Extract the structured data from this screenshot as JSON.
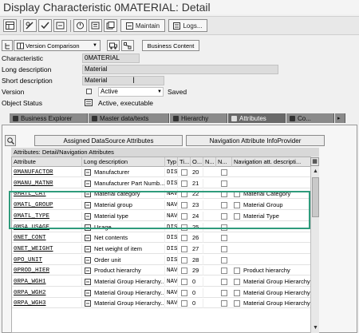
{
  "window": {
    "title": "Display Characteristic 0MATERIAL: Detail"
  },
  "toolbar": {
    "maintain_label": "Maintain",
    "logs_label": "Logs..."
  },
  "app_toolbar": {
    "version_comparison": "Version Comparison",
    "business_content": "Business Content"
  },
  "form": {
    "characteristic": {
      "label": "Characteristic",
      "value": "0MATERIAL"
    },
    "long_description": {
      "label": "Long description",
      "value": "Material"
    },
    "short_description": {
      "label": "Short description",
      "value": "Material"
    },
    "version": {
      "label": "Version",
      "value": "Active",
      "status": "Saved"
    },
    "object_status": {
      "label": "Object Status",
      "value": "Active, executable"
    }
  },
  "tabs": [
    "Business Explorer",
    "Master data/texts",
    "Hierarchy",
    "Attributes",
    "Co..."
  ],
  "active_tab": "Attributes",
  "panel": {
    "btn_assigned": "Assigned DataSource Attributes",
    "btn_nav": "Navigation Attribute InfoProvider",
    "grid_title": "Attributes: Detail/Navigation Attributes"
  },
  "grid": {
    "columns": [
      "Attribute",
      "Long description",
      "Typ",
      "Ti...",
      "O...",
      "N...",
      "T...",
      "Navigation att. descripti..."
    ],
    "rows": [
      {
        "attr": "0MANUFACTOR",
        "desc": "Manufacturer",
        "typ": "DIS",
        "o": "20",
        "nav_desc": ""
      },
      {
        "attr": "0MANU_MATNR",
        "desc": "Manufacturer Part Numb...",
        "typ": "DIS",
        "o": "21",
        "nav_desc": ""
      },
      {
        "attr": "0MATL_CAT",
        "desc": "Material category",
        "typ": "NAV",
        "o": "22",
        "nav_desc": "Material Category"
      },
      {
        "attr": "0MATL_GROUP",
        "desc": "Material group",
        "typ": "NAV",
        "o": "23",
        "nav_desc": "Material Group"
      },
      {
        "attr": "0MATL_TYPE",
        "desc": "Material type",
        "typ": "NAV",
        "o": "24",
        "nav_desc": "Material Type"
      },
      {
        "attr": "0MSA_USAGE",
        "desc": "Usage",
        "typ": "DIS",
        "o": "25",
        "nav_desc": ""
      },
      {
        "attr": "0NET_CONT",
        "desc": "Net contents",
        "typ": "DIS",
        "o": "26",
        "nav_desc": ""
      },
      {
        "attr": "0NET_WEIGHT",
        "desc": "Net weight of item",
        "typ": "DIS",
        "o": "27",
        "nav_desc": ""
      },
      {
        "attr": "0PO_UNIT",
        "desc": "Order unit",
        "typ": "DIS",
        "o": "28",
        "nav_desc": ""
      },
      {
        "attr": "0PROD_HIER",
        "desc": "Product hierarchy",
        "typ": "NAV",
        "o": "29",
        "nav_desc": "Product hierarchy"
      },
      {
        "attr": "0RPA_WGH1",
        "desc": "Material Group Hierarchy...",
        "typ": "NAV",
        "o": "0",
        "nav_desc": "Material Group Hierarchy"
      },
      {
        "attr": "0RPA_WGH2",
        "desc": "Material Group Hierarchy...",
        "typ": "NAV",
        "o": "0",
        "nav_desc": "Material Group Hierarchy"
      },
      {
        "attr": "0RPA_WGH3",
        "desc": "Material Group Hierarchy...",
        "typ": "NAV",
        "o": "0",
        "nav_desc": "Material Group Hierarchy"
      }
    ]
  },
  "colors": {
    "highlight": "#2f9b7c",
    "tab_active": "#696969",
    "tab": "#8a8a8a"
  }
}
